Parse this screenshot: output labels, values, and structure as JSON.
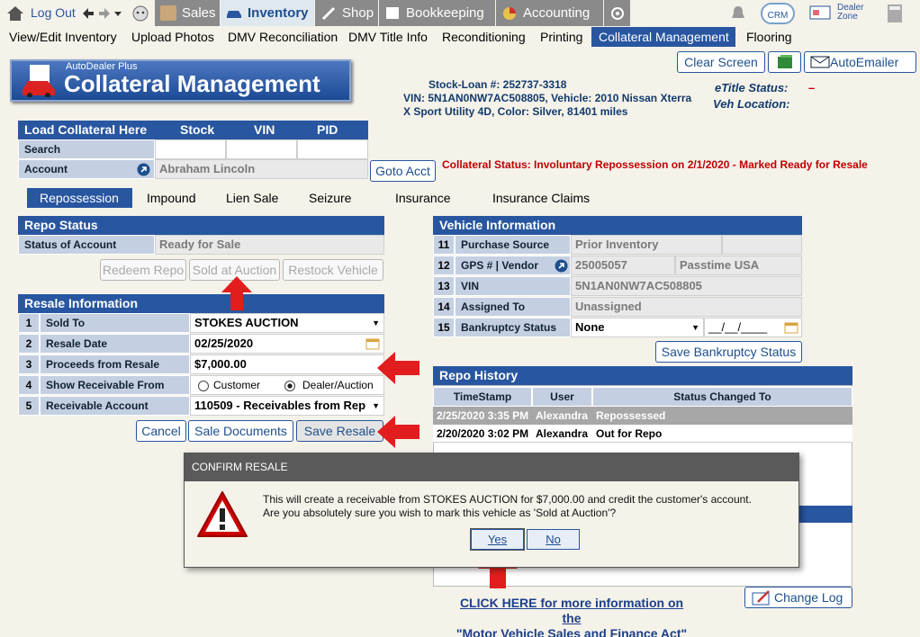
{
  "topbar": {
    "logout": "Log Out",
    "nav": [
      "Sales",
      "Inventory",
      "Shop",
      "Bookkeeping",
      "Accounting"
    ],
    "crm": "CRM",
    "dealer_zone": [
      "Dealer",
      "Zone"
    ]
  },
  "subnav": [
    "View/Edit Inventory",
    "Upload Photos",
    "DMV Reconciliation",
    "DMV Title Info",
    "Reconditioning",
    "Printing",
    "Collateral Management",
    "Flooring"
  ],
  "actions": {
    "clear": "Clear Screen",
    "autoemailer": "AutoEmailer"
  },
  "logo": {
    "small": "AutoDealer Plus",
    "big": "Collateral Management"
  },
  "vehicle": {
    "line1": "Stock-Loan #:  252737-3318",
    "line2": "VIN:  5N1AN0NW7AC508805, Vehicle:  2010 Nissan Xterra",
    "line3": "X Sport Utility 4D, Color: Silver, 81401 miles",
    "etitle_label": "eTitle Status:",
    "etitle_value": "–",
    "vehloc_label": "Veh Location:"
  },
  "load": {
    "header": "Load Collateral Here",
    "cols": [
      "Stock",
      "VIN",
      "PID"
    ],
    "search": "Search",
    "account": "Account",
    "account_value": "Abraham Lincoln",
    "goto": "Goto Acct"
  },
  "collateral_status": "Collateral Status: Involuntary Repossession on 2/1/2020 - Marked Ready for Resale",
  "tabs": [
    "Repossession",
    "Impound",
    "Lien Sale",
    "Seizure",
    "Insurance",
    "Insurance Claims"
  ],
  "repo_status": {
    "header": "Repo Status",
    "label": "Status of Account",
    "value": "Ready for Sale",
    "buttons": [
      "Redeem Repo",
      "Sold at Auction",
      "Restock Vehicle"
    ]
  },
  "resale": {
    "header": "Resale Information",
    "rows": [
      {
        "n": "1",
        "label": "Sold To",
        "value": "STOKES AUCTION"
      },
      {
        "n": "2",
        "label": "Resale Date",
        "value": "02/25/2020"
      },
      {
        "n": "3",
        "label": "Proceeds from Resale",
        "value": "$7,000.00"
      },
      {
        "n": "4",
        "label": "Show Receivable From",
        "opt1": "Customer",
        "opt2": "Dealer/Auction"
      },
      {
        "n": "5",
        "label": "Receivable Account",
        "value": "110509 - Receivables from Rep"
      }
    ],
    "buttons": [
      "Cancel",
      "Sale Documents",
      "Save Resale"
    ]
  },
  "vinfo": {
    "header": "Vehicle Information",
    "rows": [
      {
        "n": "11",
        "label": "Purchase Source",
        "value": "Prior Inventory"
      },
      {
        "n": "12",
        "label": "GPS # | Vendor",
        "value": "25005057",
        "value2": "Passtime  USA"
      },
      {
        "n": "13",
        "label": "VIN",
        "value": "5N1AN0NW7AC508805"
      },
      {
        "n": "14",
        "label": "Assigned To",
        "value": "Unassigned"
      },
      {
        "n": "15",
        "label": "Bankruptcy Status",
        "value": "None",
        "date": "__/__/____"
      }
    ],
    "save": "Save Bankruptcy Status"
  },
  "history": {
    "header": "Repo History",
    "cols": [
      "TimeStamp",
      "User",
      "Status Changed To"
    ],
    "rows": [
      [
        "2/25/2020 3:35 PM",
        "Alexandra",
        "Repossessed"
      ],
      [
        "2/20/2020 3:02 PM",
        "Alexandra",
        "Out for Repo"
      ]
    ]
  },
  "dialog": {
    "title": "CONFIRM RESALE",
    "line1": "This will create a receivable from STOKES AUCTION for $7,000.00 and credit the customer's account.",
    "line2": "Are you absolutely sure you wish to mark this vehicle as 'Sold at Auction'?",
    "yes": "Yes",
    "no": "No"
  },
  "footer": {
    "link1": "CLICK HERE for more information on the",
    "link2": "\"Motor Vehicle Sales and Finance Act\"",
    "changelog": "Change Log"
  }
}
